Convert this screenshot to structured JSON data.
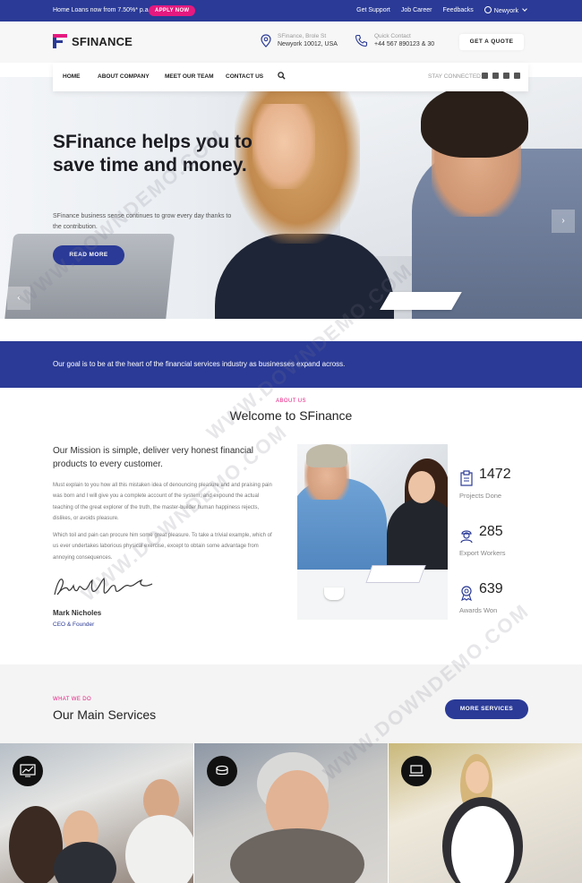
{
  "topbar": {
    "promo": "Home Loans now from 7.50%* p.a.",
    "apply": "APPLY NOW",
    "links": [
      "Get Support",
      "Job Career",
      "Feedbacks"
    ],
    "city": "Newyork"
  },
  "header": {
    "logo": "SFINANCE",
    "address_label": "SFinance, Brole St",
    "address_value": "Newyork 10012, USA",
    "contact_label": "Quick Contact",
    "contact_value": "+44 567 890123 & 30",
    "quote": "GET A QUOTE"
  },
  "nav": {
    "items": [
      "HOME",
      "ABOUT COMPANY",
      "MEET OUR TEAM",
      "CONTACT US"
    ],
    "stay": "STAY CONNECTED:",
    "social": [
      "facebook",
      "twitter",
      "linkedin",
      "linkedin"
    ]
  },
  "hero": {
    "title": "SFinance helps you to save time and money.",
    "sub": "SFinance business sense continues to grow every day thanks to the contribution.",
    "cta": "READ MORE",
    "prev": "‹",
    "next": "›"
  },
  "goal": "Our goal is to be at the heart of the financial services industry as businesses expand across.",
  "about": {
    "kicker": "ABOUT US",
    "title": "Welcome to SFinance",
    "mission": "Our Mission is simple, deliver very honest financial products to every customer.",
    "para1": "Must explain to you how all this mistaken idea of denouncing pleasure and and praising pain was born and I will give you a complete account of the system, and expound the actual teaching of the great explorer of the truth, the master-builder human happiness rejects, dislikes, or avoids pleasure.",
    "para2": "Which toil and pain can procure him some great pleasure. To take a trivial example, which of us ever undertakes laborious physical exercise, except to obtain some advantage from annoying consequences.",
    "name": "Mark Nicholes",
    "role": "CEO & Founder",
    "stats": [
      {
        "num": "1472",
        "label": "Projects Done"
      },
      {
        "num": "285",
        "label": "Export Workers"
      },
      {
        "num": "639",
        "label": "Awards Won"
      }
    ]
  },
  "services": {
    "kicker": "WHAT WE DO",
    "title": "Our Main Services",
    "cta": "MORE SERVICES"
  },
  "watermark": "WWW.DOWNDEMO.COM",
  "colors": {
    "brand": "#2a3a96",
    "accent": "#e5197f"
  }
}
